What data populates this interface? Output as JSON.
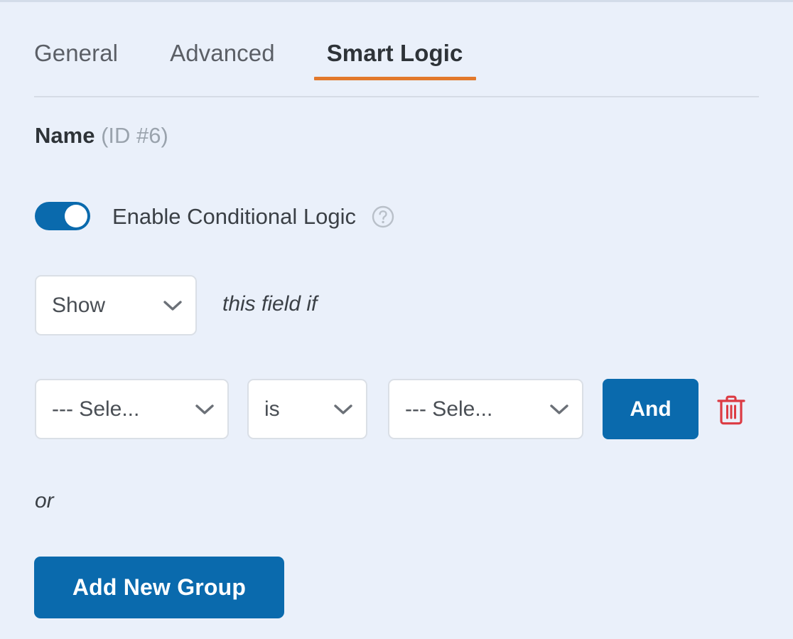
{
  "tabs": [
    {
      "label": "General",
      "active": false
    },
    {
      "label": "Advanced",
      "active": false
    },
    {
      "label": "Smart Logic",
      "active": true
    }
  ],
  "field": {
    "name": "Name",
    "id_label": "(ID #6)"
  },
  "conditional_logic": {
    "toggle_label": "Enable Conditional Logic",
    "toggle_state": "on",
    "help_icon": "question-circle-icon",
    "action_select": {
      "value": "Show",
      "chevron_icon": "chevron-down-icon"
    },
    "rule_prefix": "this field if",
    "condition": {
      "field_select": {
        "value": "--- Sele...",
        "chevron_icon": "chevron-down-icon"
      },
      "operator_select": {
        "value": "is",
        "chevron_icon": "chevron-down-icon"
      },
      "value_select": {
        "value": "--- Sele...",
        "chevron_icon": "chevron-down-icon"
      },
      "and_button": "And",
      "delete_icon": "trash-icon"
    },
    "or_text": "or",
    "add_group_button": "Add New Group"
  },
  "colors": {
    "background": "#eaf0fa",
    "accent_orange": "#e2792c",
    "primary_blue": "#0a6aad",
    "danger_red": "#dc3b43",
    "text_dark": "#2e3338",
    "text_muted": "#9aa3ad",
    "border": "#dadfe6"
  }
}
